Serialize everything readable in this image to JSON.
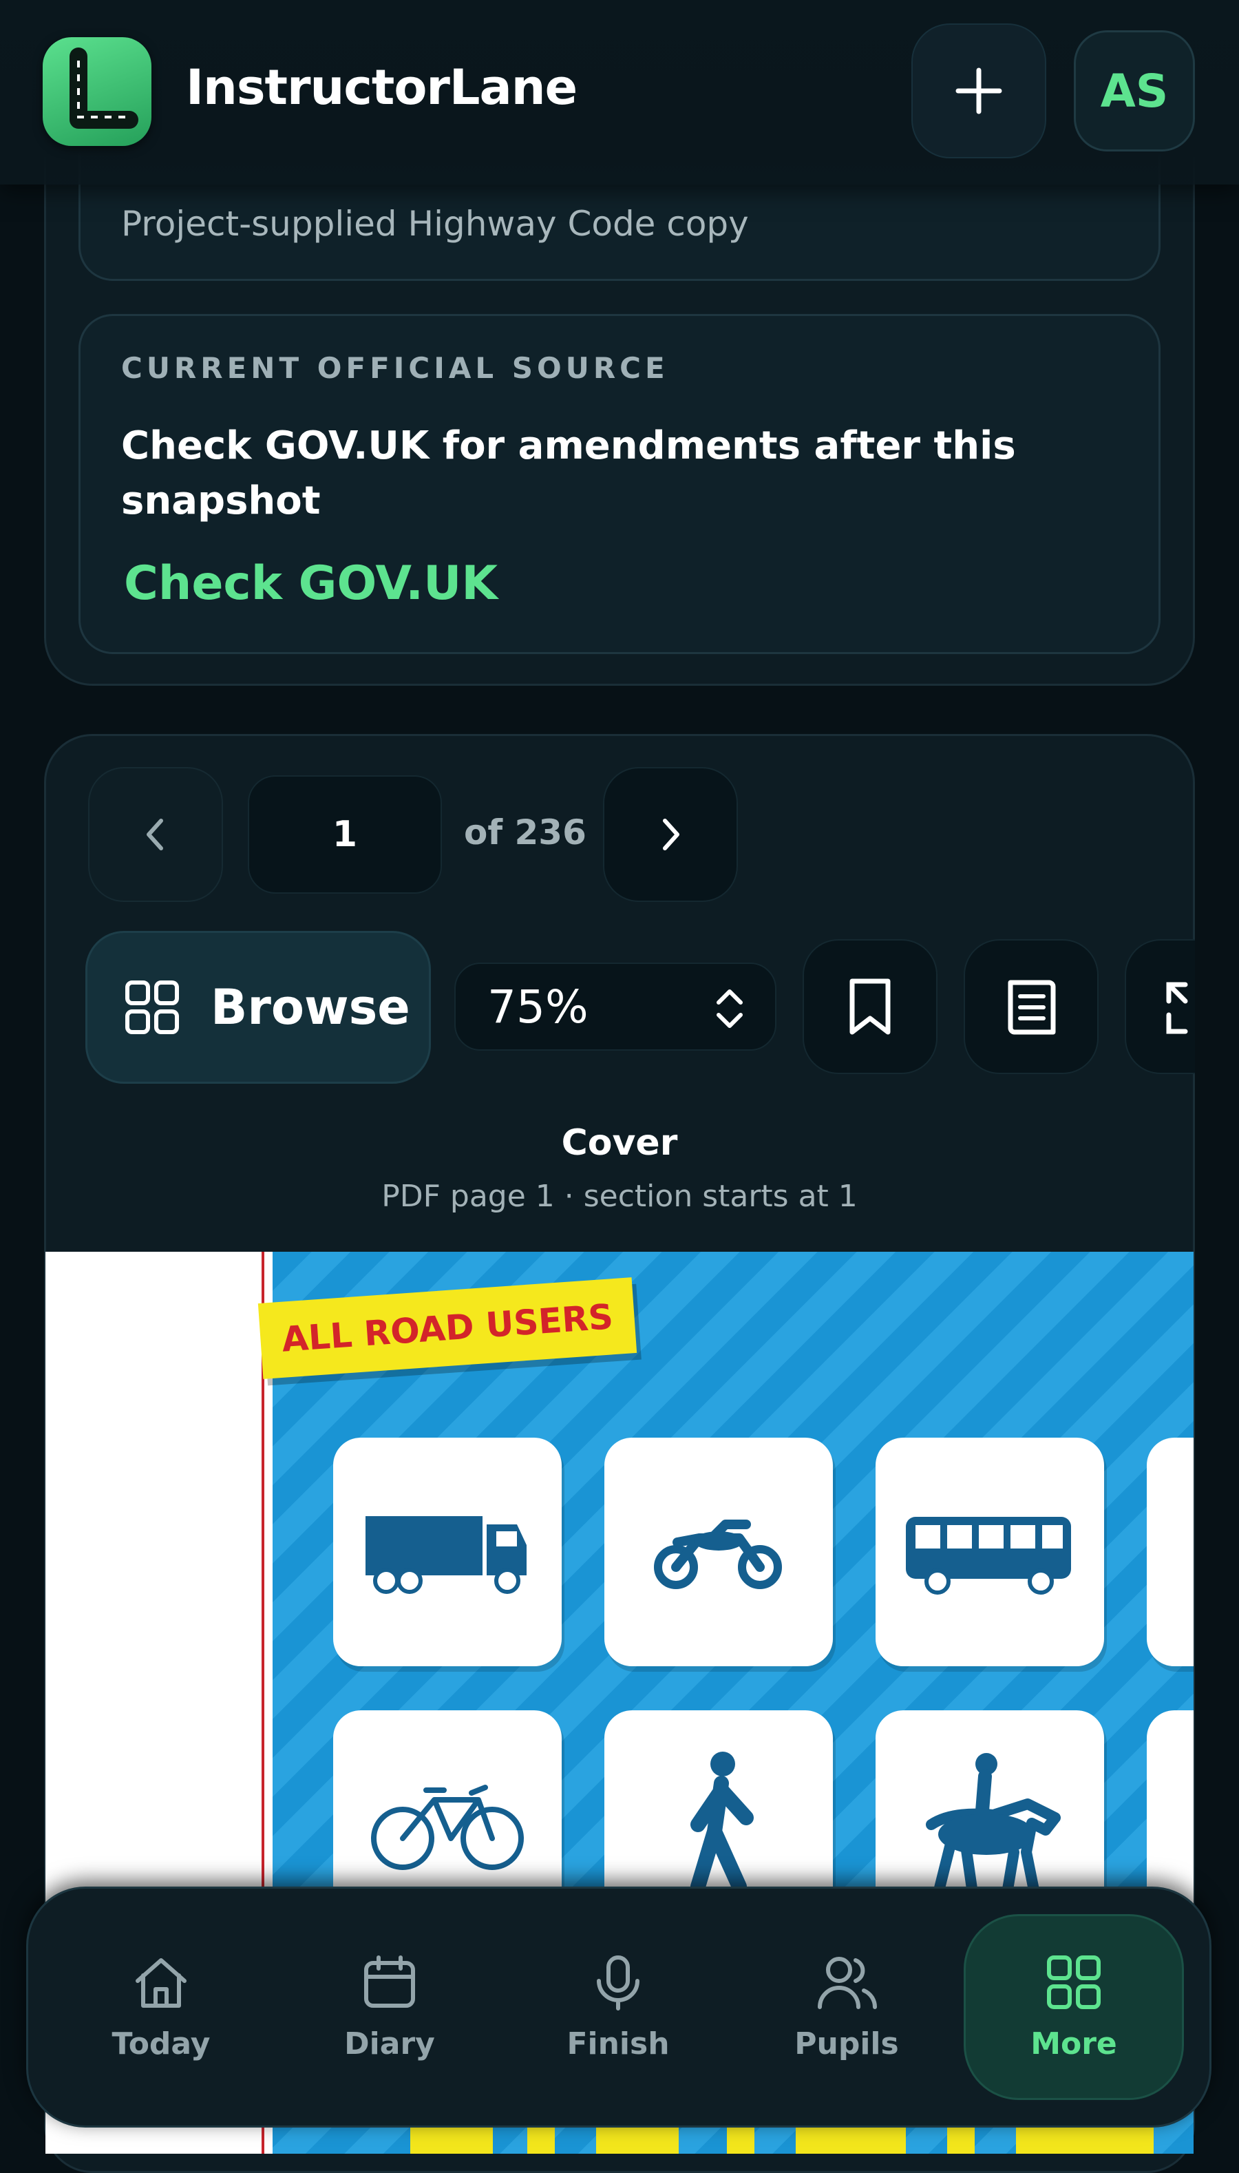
{
  "app": {
    "title": "InstructorLane",
    "avatar_initials": "AS",
    "accent": "#5de38f"
  },
  "source": {
    "text": "Project-supplied Highway Code copy",
    "official_label": "CURRENT OFFICIAL SOURCE",
    "official_desc": "Check GOV.UK for amendments after this snapshot",
    "link": "Check GOV.UK"
  },
  "viewer": {
    "page": "1",
    "of_total": "of 236",
    "browse": "Browse",
    "zoom": "75%",
    "section_title": "Cover",
    "section_sub": "PDF page 1 · section starts at 1"
  },
  "cover": {
    "banner": "ALL ROAD USERS"
  },
  "nav": [
    {
      "label": "Today",
      "icon": "home-icon"
    },
    {
      "label": "Diary",
      "icon": "calendar-icon"
    },
    {
      "label": "Finish",
      "icon": "microphone-icon"
    },
    {
      "label": "Pupils",
      "icon": "users-icon"
    },
    {
      "label": "More",
      "icon": "grid-icon",
      "active": true
    }
  ]
}
